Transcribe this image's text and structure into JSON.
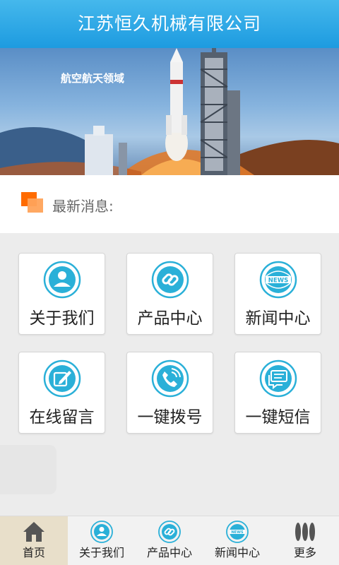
{
  "header": {
    "title": "江苏恒久机械有限公司"
  },
  "banner": {
    "caption": "航空航天领域"
  },
  "news": {
    "label": "最新消息:"
  },
  "tiles": [
    {
      "label": "关于我们",
      "icon": "person-icon"
    },
    {
      "label": "产品中心",
      "icon": "link-icon"
    },
    {
      "label": "新闻中心",
      "icon": "news-globe-icon",
      "icon_text": "NEWS"
    },
    {
      "label": "在线留言",
      "icon": "edit-icon"
    },
    {
      "label": "一键拨号",
      "icon": "phone-icon"
    },
    {
      "label": "一键短信",
      "icon": "message-icon"
    }
  ],
  "tabbar": [
    {
      "label": "首页",
      "icon": "home-icon",
      "active": true
    },
    {
      "label": "关于我们",
      "icon": "person-icon"
    },
    {
      "label": "产品中心",
      "icon": "link-icon"
    },
    {
      "label": "新闻中心",
      "icon": "news-globe-icon",
      "icon_text": "NEWS"
    },
    {
      "label": "更多",
      "icon": "more-icon"
    }
  ],
  "colors": {
    "header": "#1d9be0",
    "accent": "#2ab0d8",
    "news_icon": "#ff6b00",
    "active_tab": "#e8dfca"
  }
}
